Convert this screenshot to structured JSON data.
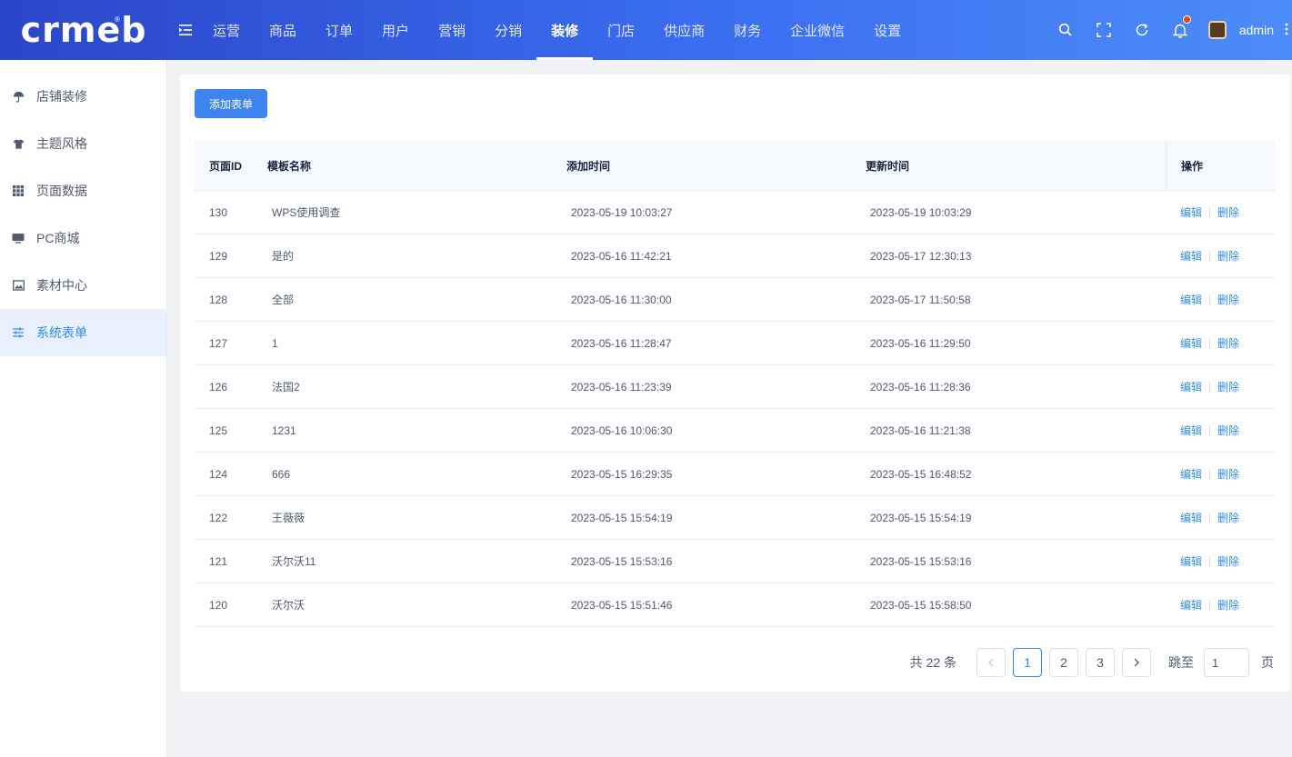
{
  "header": {
    "logo": "crmeb",
    "logo_mark": "®",
    "nav": [
      "运营",
      "商品",
      "订单",
      "用户",
      "营销",
      "分销",
      "装修",
      "门店",
      "供应商",
      "财务",
      "企业微信",
      "设置"
    ],
    "active_nav": "装修",
    "username": "admin",
    "icons": [
      "search-icon",
      "fullscreen-icon",
      "refresh-icon",
      "bell-icon",
      "more-icon"
    ],
    "brand_colors": {
      "start": "#2a46c9",
      "end": "#4c8cf8"
    }
  },
  "sidebar": {
    "items": [
      {
        "label": "店铺装修",
        "icon": "umbrella-icon",
        "active": false
      },
      {
        "label": "主题风格",
        "icon": "shirt-icon",
        "active": false
      },
      {
        "label": "页面数据",
        "icon": "grid-icon",
        "active": false
      },
      {
        "label": "PC商城",
        "icon": "monitor-icon",
        "active": false
      },
      {
        "label": "素材中心",
        "icon": "image-icon",
        "active": false
      },
      {
        "label": "系统表单",
        "icon": "sliders-icon",
        "active": true
      }
    ],
    "accent": "#2d8cf0"
  },
  "main": {
    "add_button": "添加表单",
    "columns": [
      "页面ID",
      "模板名称",
      "添加时间",
      "更新时间",
      "操作"
    ],
    "rows": [
      {
        "id": "130",
        "name": "WPS使用调查",
        "added": "2023-05-19 10:03:27",
        "updated": "2023-05-19 10:03:29"
      },
      {
        "id": "129",
        "name": "是的",
        "added": "2023-05-16 11:42:21",
        "updated": "2023-05-17 12:30:13"
      },
      {
        "id": "128",
        "name": "全部",
        "added": "2023-05-16 11:30:00",
        "updated": "2023-05-17 11:50:58"
      },
      {
        "id": "127",
        "name": "1",
        "added": "2023-05-16 11:28:47",
        "updated": "2023-05-16 11:29:50"
      },
      {
        "id": "126",
        "name": "法国2",
        "added": "2023-05-16 11:23:39",
        "updated": "2023-05-16 11:28:36"
      },
      {
        "id": "125",
        "name": "1231",
        "added": "2023-05-16 10:06:30",
        "updated": "2023-05-16 11:21:38"
      },
      {
        "id": "124",
        "name": "666",
        "added": "2023-05-15 16:29:35",
        "updated": "2023-05-15 16:48:52"
      },
      {
        "id": "122",
        "name": "王薇薇",
        "added": "2023-05-15 15:54:19",
        "updated": "2023-05-15 15:54:19"
      },
      {
        "id": "121",
        "name": "沃尔沃11",
        "added": "2023-05-15 15:53:16",
        "updated": "2023-05-15 15:53:16"
      },
      {
        "id": "120",
        "name": "沃尔沃",
        "added": "2023-05-15 15:51:46",
        "updated": "2023-05-15 15:58:50"
      }
    ],
    "op_edit": "编辑",
    "op_delete": "删除"
  },
  "pagination": {
    "total": "共 22 条",
    "pages": [
      "1",
      "2",
      "3"
    ],
    "current": "1",
    "jump_label": "跳至",
    "jump_value": "1",
    "page_unit": "页"
  }
}
